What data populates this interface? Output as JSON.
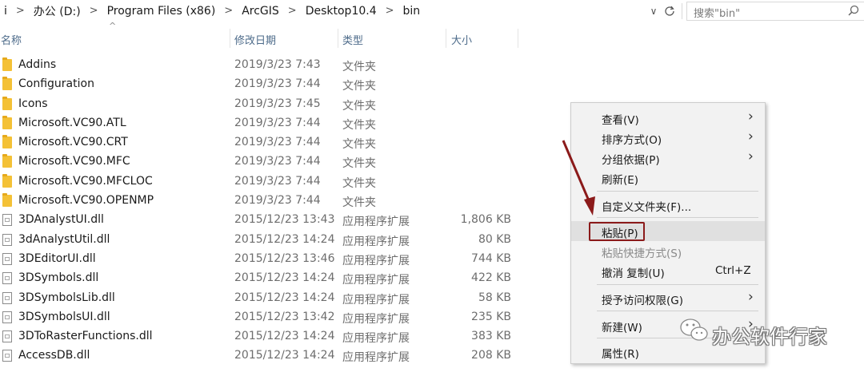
{
  "address": {
    "crumbs": [
      "i",
      "办公 (D:)",
      "Program Files (x86)",
      "ArcGIS",
      "Desktop10.4",
      "bin"
    ],
    "search_placeholder": "搜索\"bin\""
  },
  "columns": {
    "name": "名称",
    "modified": "修改日期",
    "type": "类型",
    "size": "大小"
  },
  "files": [
    {
      "name": "Addins",
      "date": "2019/3/23 7:43",
      "type": "文件夹",
      "size": "",
      "kind": "folder"
    },
    {
      "name": "Configuration",
      "date": "2019/3/23 7:44",
      "type": "文件夹",
      "size": "",
      "kind": "folder"
    },
    {
      "name": "Icons",
      "date": "2019/3/23 7:45",
      "type": "文件夹",
      "size": "",
      "kind": "folder"
    },
    {
      "name": "Microsoft.VC90.ATL",
      "date": "2019/3/23 7:44",
      "type": "文件夹",
      "size": "",
      "kind": "folder"
    },
    {
      "name": "Microsoft.VC90.CRT",
      "date": "2019/3/23 7:44",
      "type": "文件夹",
      "size": "",
      "kind": "folder"
    },
    {
      "name": "Microsoft.VC90.MFC",
      "date": "2019/3/23 7:44",
      "type": "文件夹",
      "size": "",
      "kind": "folder"
    },
    {
      "name": "Microsoft.VC90.MFCLOC",
      "date": "2019/3/23 7:44",
      "type": "文件夹",
      "size": "",
      "kind": "folder"
    },
    {
      "name": "Microsoft.VC90.OPENMP",
      "date": "2019/3/23 7:44",
      "type": "文件夹",
      "size": "",
      "kind": "folder"
    },
    {
      "name": "3DAnalystUI.dll",
      "date": "2015/12/23 13:43",
      "type": "应用程序扩展",
      "size": "1,806 KB",
      "kind": "file"
    },
    {
      "name": "3dAnalystUtil.dll",
      "date": "2015/12/23 14:24",
      "type": "应用程序扩展",
      "size": "80 KB",
      "kind": "file"
    },
    {
      "name": "3DEditorUI.dll",
      "date": "2015/12/23 13:46",
      "type": "应用程序扩展",
      "size": "744 KB",
      "kind": "file"
    },
    {
      "name": "3DSymbols.dll",
      "date": "2015/12/23 14:24",
      "type": "应用程序扩展",
      "size": "422 KB",
      "kind": "file"
    },
    {
      "name": "3DSymbolsLib.dll",
      "date": "2015/12/23 14:24",
      "type": "应用程序扩展",
      "size": "58 KB",
      "kind": "file"
    },
    {
      "name": "3DSymbolsUI.dll",
      "date": "2015/12/23 13:42",
      "type": "应用程序扩展",
      "size": "235 KB",
      "kind": "file"
    },
    {
      "name": "3DToRasterFunctions.dll",
      "date": "2015/12/23 14:24",
      "type": "应用程序扩展",
      "size": "383 KB",
      "kind": "file"
    },
    {
      "name": "AccessDB.dll",
      "date": "2015/12/23 14:24",
      "type": "应用程序扩展",
      "size": "208 KB",
      "kind": "file"
    }
  ],
  "menu": {
    "view": "查看(V)",
    "sort": "排序方式(O)",
    "group": "分组依据(P)",
    "refresh": "刷新(E)",
    "customize": "自定义文件夹(F)...",
    "paste": "粘贴(P)",
    "paste_shortcut": "粘贴快捷方式(S)",
    "undo_copy": "撤消 复制(U)",
    "undo_accel": "Ctrl+Z",
    "grant_access": "授予访问权限(G)",
    "new": "新建(W)",
    "properties": "属性(R)"
  },
  "watermark": "办公软件行家",
  "colors": {
    "header_text": "#4d6b8a",
    "annotation": "#8b1a1a",
    "folder": "#f4c136"
  }
}
